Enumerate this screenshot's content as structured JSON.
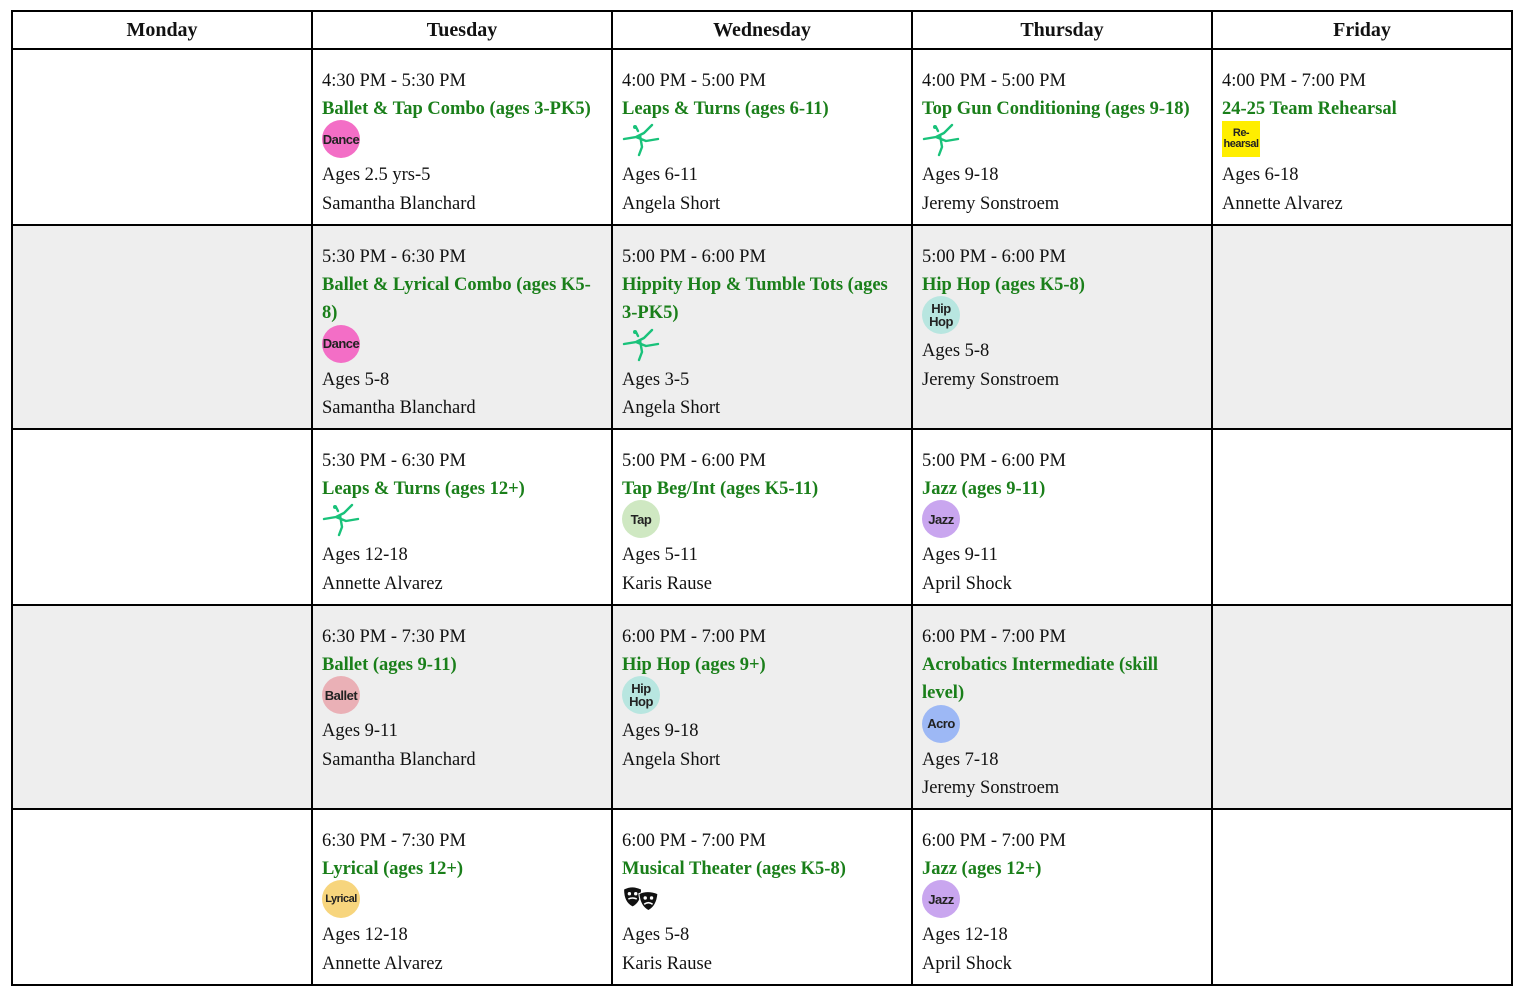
{
  "days": [
    "Monday",
    "Tuesday",
    "Wednesday",
    "Thursday",
    "Friday"
  ],
  "colors": {
    "class_name": "#1a7f1a",
    "row_shade": "#eeeeee",
    "dance": "#f36ec6",
    "hiphop": "#b8e6e0",
    "tap": "#cfe8c2",
    "jazz": "#c9a6ef",
    "ballet": "#eab0b6",
    "acro": "#9db8f5",
    "lyrical": "#f7d57d",
    "rehearsal": "#ffee00",
    "leap": "#19c27a"
  },
  "rows": [
    {
      "tuesday": {
        "time": "4:30 PM - 5:30 PM",
        "name": "Ballet & Tap Combo (ages 3-PK5)",
        "icon": "dance-badge-icon",
        "badge": "Dance",
        "ages": "Ages 2.5 yrs-5",
        "instructor": "Samantha Blanchard"
      },
      "wednesday": {
        "time": "4:00 PM - 5:00 PM",
        "name": "Leaps & Turns (ages 6-11)",
        "icon": "leaping-dancer-icon",
        "ages": "Ages 6-11",
        "instructor": "Angela  Short"
      },
      "thursday": {
        "time": "4:00 PM - 5:00 PM",
        "name": "Top Gun Conditioning (ages 9-18)",
        "icon": "leaping-dancer-icon",
        "ages": "Ages 9-18",
        "instructor": "Jeremy Sonstroem"
      },
      "friday": {
        "time": "4:00 PM - 7:00 PM",
        "name": "24-25 Team Rehearsal",
        "icon": "rehearsal-badge-icon",
        "badge_top": "Re-",
        "badge_bottom": "hearsal",
        "ages": "Ages 6-18",
        "instructor": "Annette  Alvarez"
      }
    },
    {
      "tuesday": {
        "time": "5:30 PM - 6:30 PM",
        "name": "Ballet & Lyrical Combo (ages K5-8)",
        "icon": "dance-badge-icon",
        "badge": "Dance",
        "ages": "Ages 5-8",
        "instructor": "Samantha Blanchard"
      },
      "wednesday": {
        "time": "5:00 PM - 6:00 PM",
        "name": "Hippity Hop & Tumble Tots (ages 3-PK5)",
        "icon": "leaping-dancer-icon",
        "ages": "Ages 3-5",
        "instructor": "Angela  Short"
      },
      "thursday": {
        "time": "5:00 PM - 6:00 PM",
        "name": "Hip Hop (ages K5-8)",
        "icon": "hiphop-badge-icon",
        "badge_top": "Hip",
        "badge_bottom": "Hop",
        "ages": "Ages 5-8",
        "instructor": "Jeremy Sonstroem"
      }
    },
    {
      "tuesday": {
        "time": "5:30 PM - 6:30 PM",
        "name": "Leaps & Turns (ages 12+)",
        "icon": "leaping-dancer-icon",
        "ages": "Ages 12-18",
        "instructor": "Annette  Alvarez"
      },
      "wednesday": {
        "time": "5:00 PM - 6:00 PM",
        "name": "Tap Beg/Int (ages K5-11)",
        "icon": "tap-badge-icon",
        "badge": "Tap",
        "ages": "Ages 5-11",
        "instructor": "Karis Rause"
      },
      "thursday": {
        "time": "5:00 PM - 6:00 PM",
        "name": "Jazz (ages 9-11)",
        "icon": "jazz-badge-icon",
        "badge": "Jazz",
        "ages": "Ages 9-11",
        "instructor": "April  Shock"
      }
    },
    {
      "tuesday": {
        "time": "6:30 PM - 7:30 PM",
        "name": "Ballet (ages 9-11)",
        "icon": "ballet-badge-icon",
        "badge": "Ballet",
        "ages": "Ages 9-11",
        "instructor": "Samantha Blanchard"
      },
      "wednesday": {
        "time": "6:00 PM - 7:00 PM",
        "name": "Hip Hop (ages 9+)",
        "icon": "hiphop-badge-icon",
        "badge_top": "Hip",
        "badge_bottom": "Hop",
        "ages": "Ages 9-18",
        "instructor": "Angela  Short"
      },
      "thursday": {
        "time": "6:00 PM - 7:00 PM",
        "name": "Acrobatics Intermediate (skill level)",
        "icon": "acro-badge-icon",
        "badge": "Acro",
        "ages": "Ages 7-18",
        "instructor": "Jeremy Sonstroem"
      }
    },
    {
      "tuesday": {
        "time": "6:30 PM - 7:30 PM",
        "name": "Lyrical (ages 12+)",
        "icon": "lyrical-badge-icon",
        "badge": "Lyrical",
        "ages": "Ages 12-18",
        "instructor": "Annette  Alvarez"
      },
      "wednesday": {
        "time": "6:00 PM - 7:00 PM",
        "name": "Musical Theater (ages K5-8)",
        "icon": "theater-masks-icon",
        "ages": "Ages 5-8",
        "instructor": "Karis Rause"
      },
      "thursday": {
        "time": "6:00 PM - 7:00 PM",
        "name": "Jazz (ages 12+)",
        "icon": "jazz-badge-icon",
        "badge": "Jazz",
        "ages": "Ages 12-18",
        "instructor": "April  Shock"
      }
    }
  ]
}
